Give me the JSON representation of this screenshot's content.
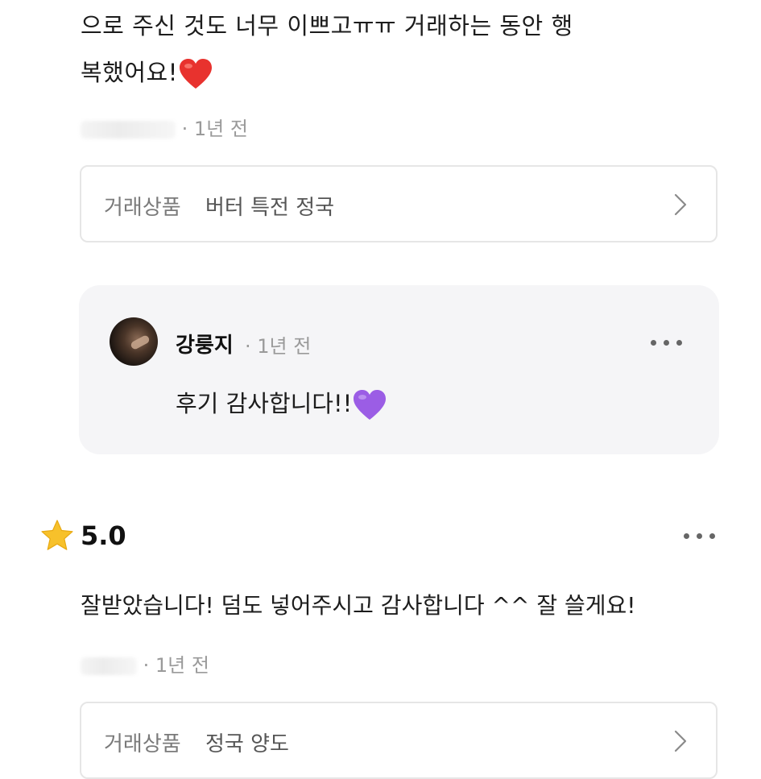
{
  "review1": {
    "text_line1": "으로 주신 것도 너무 이쁘고ㅠㅠ 거래하는 동안 행",
    "text_line2": "복했어요!",
    "emoji": "heart-red",
    "time": "· 1년 전",
    "trade_label": "거래상품",
    "trade_item": "버터 특전 정국"
  },
  "reply": {
    "name": "강룽지",
    "time": "· 1년 전",
    "text": "후기 감사합니다!!",
    "emoji": "heart-purple"
  },
  "review2": {
    "rating": "5.0",
    "text": "잘받았습니다! 덤도 넣어주시고 감사합니다 ^^ 잘 쓸게요!",
    "time": "· 1년 전",
    "trade_label": "거래상품",
    "trade_item": "정국 양도"
  },
  "colors": {
    "star": "#f7c12b",
    "heart_red": "#e8322e",
    "heart_purple": "#9b5de5",
    "reply_bg": "#f5f5f7"
  }
}
